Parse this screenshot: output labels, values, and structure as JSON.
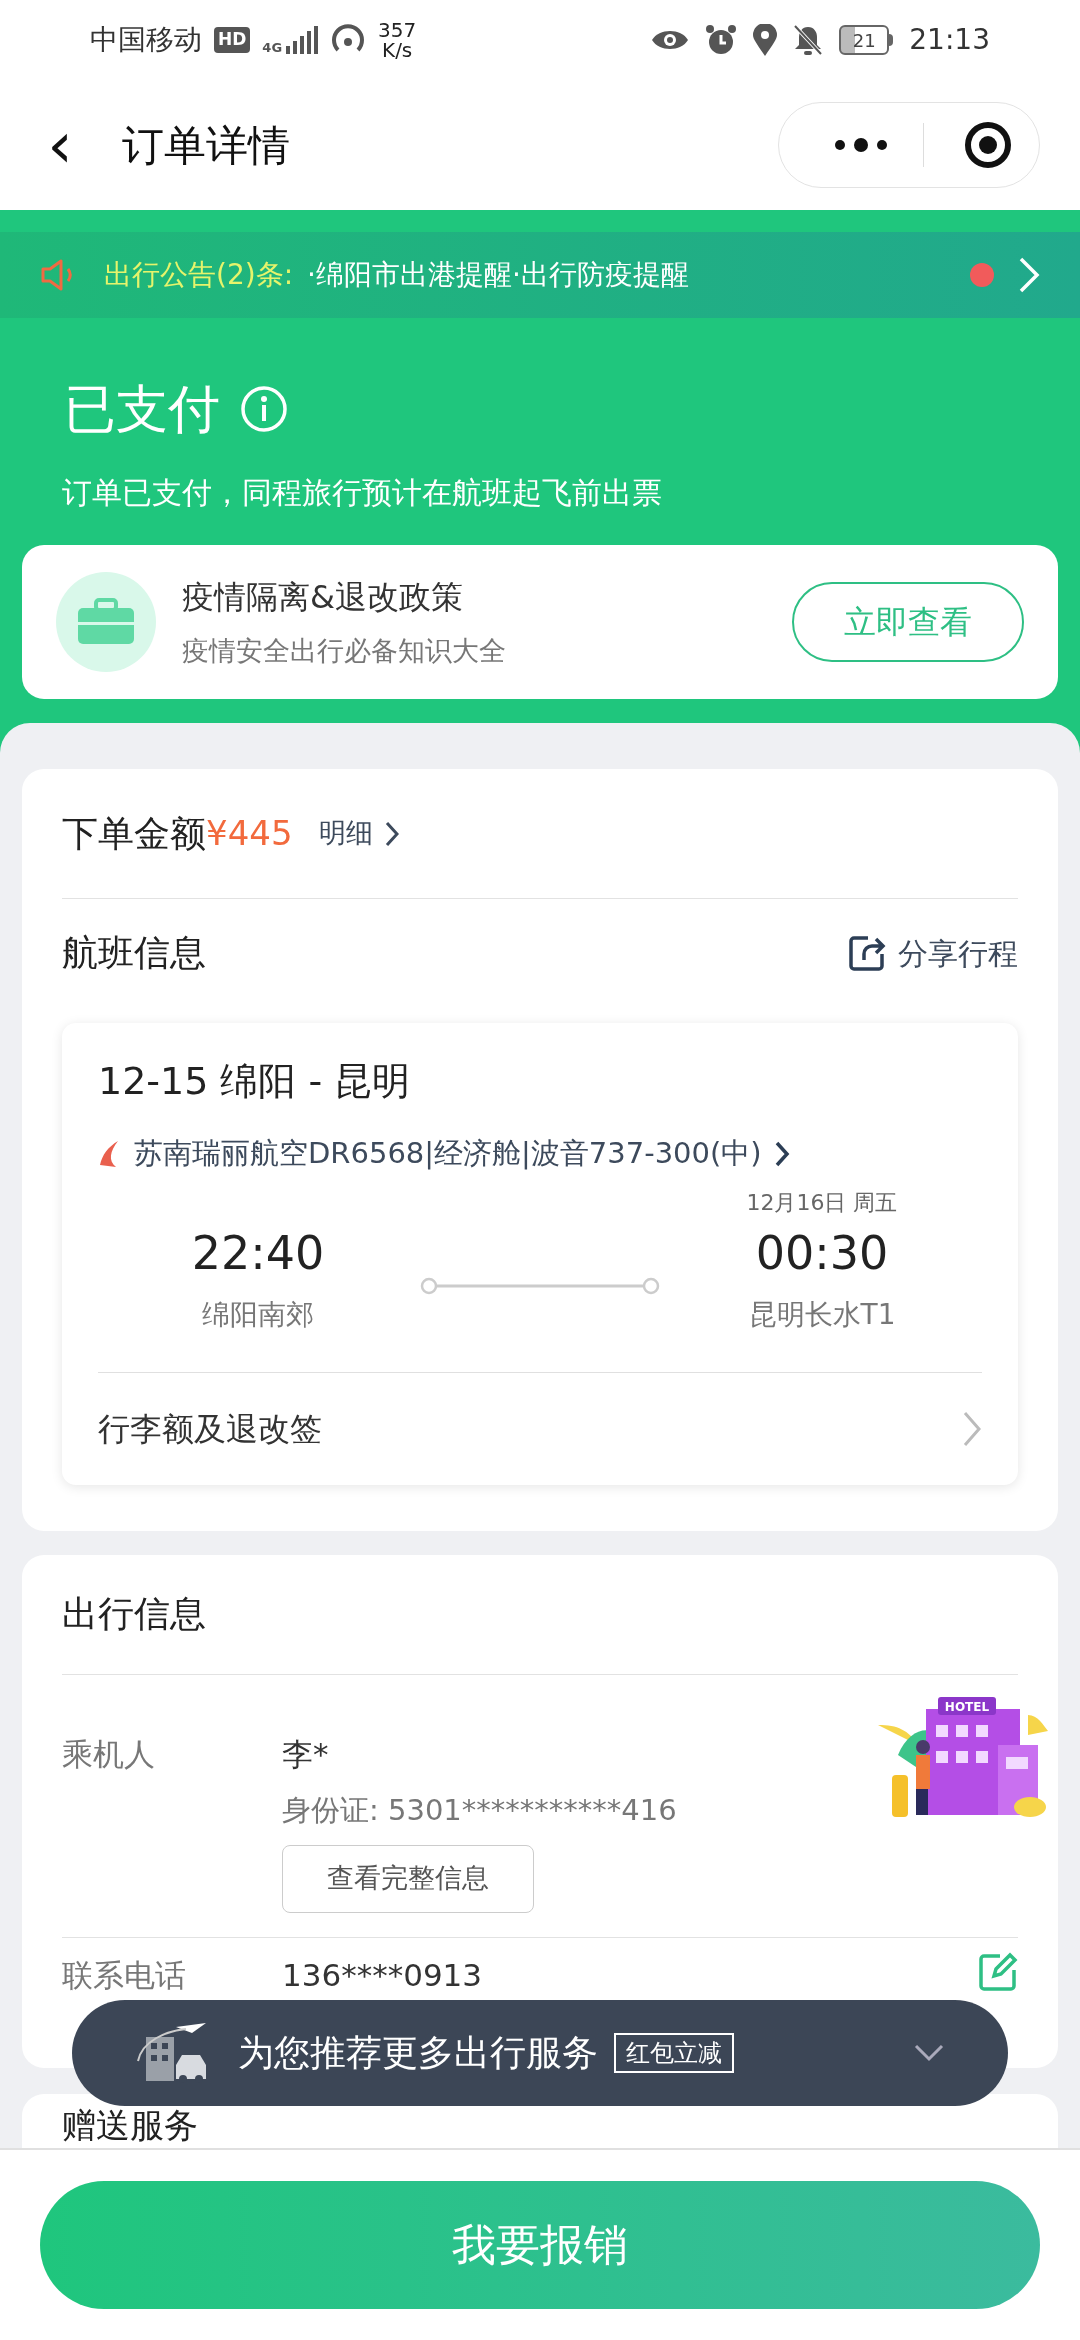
{
  "status_bar": {
    "carrier": "中国移动",
    "hd": "HD",
    "network": "4G",
    "speed": "357",
    "speed_unit": "K/s",
    "battery": "21",
    "time": "21:13"
  },
  "nav": {
    "title": "订单详情",
    "back": "‹"
  },
  "notice": {
    "label": "出行公告(2)条:",
    "items": "·绵阳市出港提醒·出行防疫提醒",
    "unread": true
  },
  "status": {
    "title": "已支付",
    "subtitle": "订单已支付，同程旅行预计在航班起飞前出票"
  },
  "policy": {
    "title": "疫情隔离&退改政策",
    "subtitle": "疫情安全出行必备知识大全",
    "button": "立即查看"
  },
  "order": {
    "label": "下单金额",
    "amount": "¥445",
    "detail": "明细"
  },
  "flight_section": {
    "title": "航班信息",
    "share": "分享行程"
  },
  "flight": {
    "route": "12-15 绵阳 - 昆明",
    "airline": "苏南瑞丽航空DR6568|经济舱|波音737-300(中)",
    "dep_time": "22:40",
    "dep_airport": "绵阳南郊",
    "arr_date": "12月16日 周五",
    "arr_time": "00:30",
    "arr_airport": "昆明长水T1",
    "baggage": "行李额及退改签"
  },
  "travel": {
    "title": "出行信息",
    "passenger_label": "乘机人",
    "passenger": "李*",
    "id": "身份证: 5301***********416",
    "view_button": "查看完整信息",
    "contact_label": "联系电话",
    "phone": "136****0913",
    "hotel_sign": "HOTEL"
  },
  "next_section": {
    "title": "赠送服务"
  },
  "banner": {
    "text": "为您推荐更多出行服务",
    "tag": "红包立减"
  },
  "bottom_button": "我要报销"
}
